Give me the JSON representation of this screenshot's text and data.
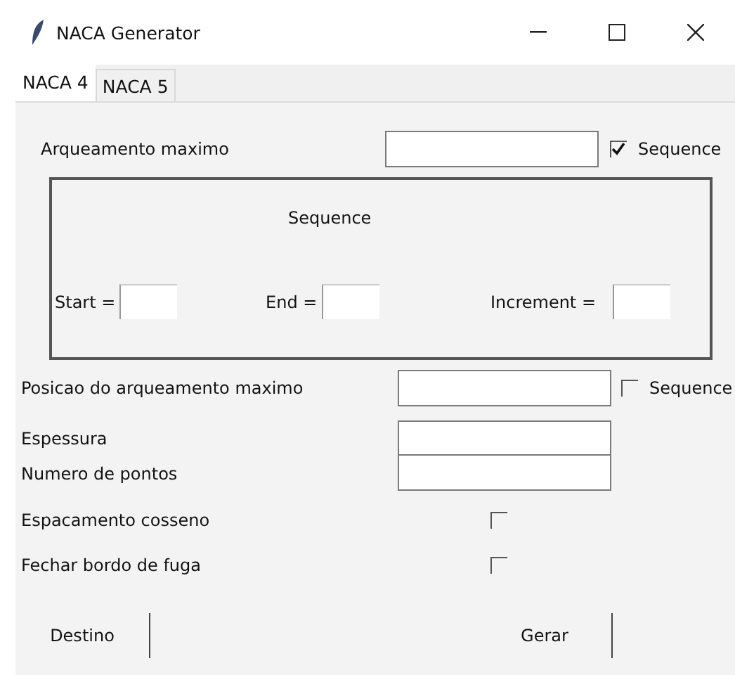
{
  "window": {
    "title": "NACA Generator"
  },
  "tabs": [
    {
      "label": "NACA 4",
      "selected": true
    },
    {
      "label": "NACA 5",
      "selected": false
    }
  ],
  "max_camber": {
    "label": "Arqueamento maximo",
    "sequence": {
      "label": "Sequence",
      "checked": true
    }
  },
  "sequence_frame": {
    "title": "Sequence",
    "fields": [
      {
        "label": "Start ="
      },
      {
        "label": "End ="
      },
      {
        "label": "Increment ="
      }
    ]
  },
  "camber_position": {
    "label": "Posicao do arqueamento maximo",
    "sequence": {
      "label": "Sequence",
      "checked": false
    }
  },
  "fields": [
    {
      "label": "Espessura"
    },
    {
      "label": "Numero de pontos"
    }
  ],
  "options": [
    {
      "label": "Espacamento cosseno",
      "checked": false
    },
    {
      "label": "Fechar bordo de fuga",
      "checked": false
    }
  ],
  "buttons": [
    {
      "label": "Destino"
    },
    {
      "label": "Gerar"
    }
  ]
}
